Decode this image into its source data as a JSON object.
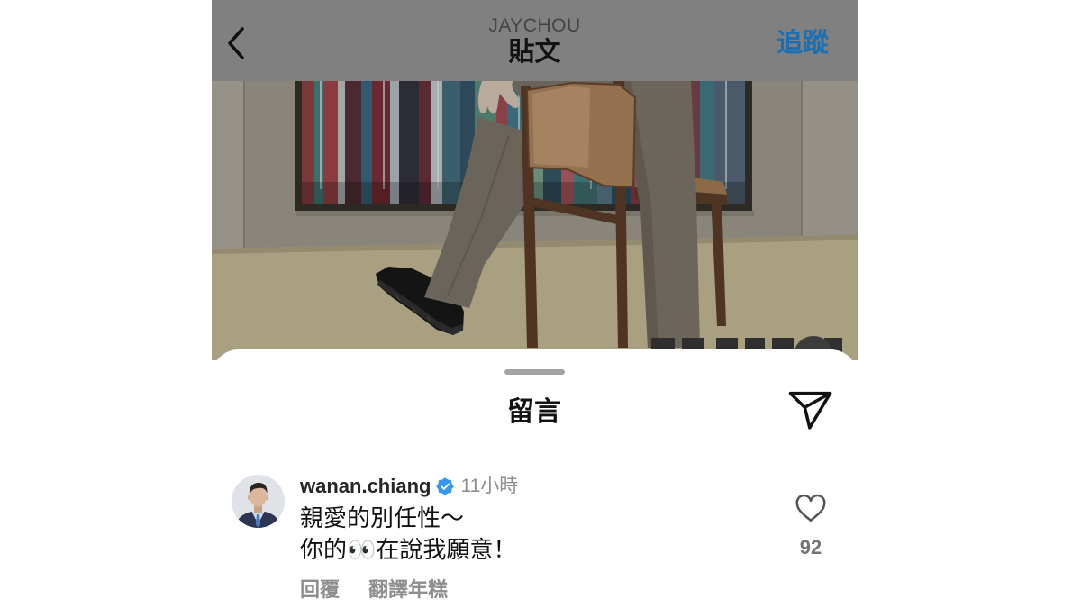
{
  "theme": {
    "accent": "#1d6fb3",
    "header_bg": "#808080",
    "verified": "#3897f0",
    "text_primary": "#262626",
    "text_secondary": "#8e8e8e"
  },
  "header": {
    "back_icon": "chevron-left-icon",
    "account_name": "JAYCHOU",
    "title": "貼文",
    "follow_label": "追蹤"
  },
  "comments_sheet": {
    "title": "留言",
    "share_icon": "send-icon",
    "comments": [
      {
        "username": "wanan.chiang",
        "verified": true,
        "verified_icon": "verified-badge-icon",
        "time_ago": "11小時",
        "text_lines": [
          "親愛的別任性～",
          "你的👀在說我願意！"
        ],
        "reply_label": "回覆",
        "translate_label": "翻譯年糕",
        "like_icon": "heart-outline-icon",
        "like_count": "92"
      }
    ]
  }
}
